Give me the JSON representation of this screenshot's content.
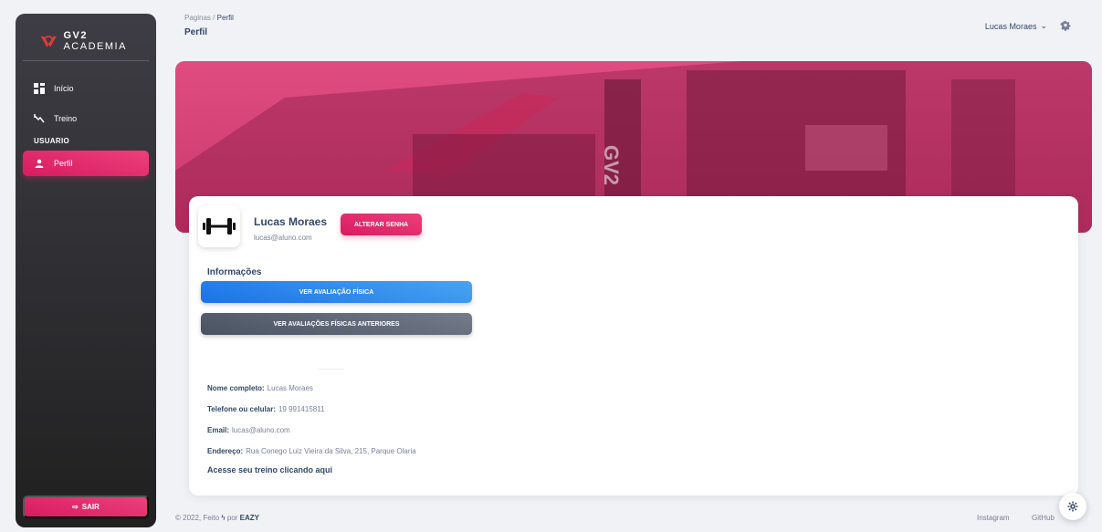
{
  "app": {
    "brand_bold": "GV2",
    "brand_light": "ACADEMIA"
  },
  "sidebar": {
    "items": [
      {
        "label": "Início",
        "icon": "dashboard-icon"
      },
      {
        "label": "Treino",
        "icon": "trend-icon"
      }
    ],
    "section": "USUARIO",
    "active_item": {
      "label": "Perfil",
      "icon": "person-icon"
    },
    "logout_label": "SAIR"
  },
  "header": {
    "breadcrumb_root": "Paginas",
    "breadcrumb_sep": "/",
    "breadcrumb_current": "Perfil",
    "title": "Perfil",
    "user_name": "Lucas Moraes"
  },
  "profile": {
    "name": "Lucas Moraes",
    "email": "lucas@aluno.com",
    "change_password_label": "ALTERAR SENHA",
    "info_title": "Informações",
    "btn_assessment": "VER AVALIAÇÃO FÍSICA",
    "btn_previous": "VER AVALIAÇÕES FÍSICAS ANTERIORES",
    "details": [
      {
        "label": "Nome completo:",
        "value": "Lucas Moraes"
      },
      {
        "label": "Telefone ou celular:",
        "value": "19 991415811"
      },
      {
        "label": "Email:",
        "value": "lucas@aluno.com"
      },
      {
        "label": "Endereço:",
        "value": "Rua Conego Luiz Vieira da Silva, 215, Parque Olaria"
      }
    ],
    "training_link": "Acesse seu treino clicando aqui"
  },
  "footer": {
    "copyright": "© 2022, Feito",
    "by": "por",
    "brand": "EAZY",
    "links": [
      "Instagram",
      "GitHub"
    ]
  },
  "colors": {
    "accent": "#e91e63",
    "blue": "#1a73e8",
    "gray": "#495361"
  }
}
